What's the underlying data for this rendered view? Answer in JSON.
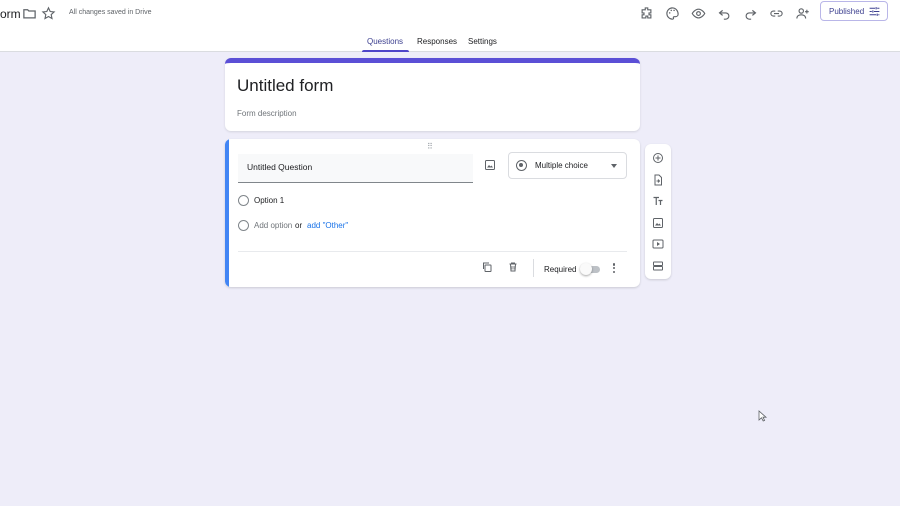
{
  "header": {
    "doc_title": "orm",
    "save_status": "All changes saved in Drive",
    "publish_label": "Published",
    "icons": [
      "folder-icon",
      "star-icon",
      "add-ons-icon",
      "palette-icon",
      "preview-eye-icon",
      "undo-icon",
      "redo-icon",
      "link-icon",
      "add-collaborator-icon",
      "tune-icon"
    ]
  },
  "tabs": [
    {
      "label": "Questions",
      "active": true
    },
    {
      "label": "Responses",
      "active": false
    },
    {
      "label": "Settings",
      "active": false
    }
  ],
  "form": {
    "title": "Untitled form",
    "description_placeholder": "Form description"
  },
  "question": {
    "title": "Untitled Question",
    "type": "Multiple choice",
    "options": [
      "Option 1"
    ],
    "add_option": "Add option",
    "or": "or",
    "add_other": "add \"Other\"",
    "required_label": "Required",
    "required": false
  },
  "side_toolbar": [
    "add-question-icon",
    "import-questions-icon",
    "add-title-text-icon",
    "add-image-icon",
    "add-video-icon",
    "add-section-icon"
  ],
  "colors": {
    "background": "#eeedf9",
    "theme_accent": "#5b4fd6",
    "question_accent": "#4285f4",
    "link": "#1a73e8"
  }
}
